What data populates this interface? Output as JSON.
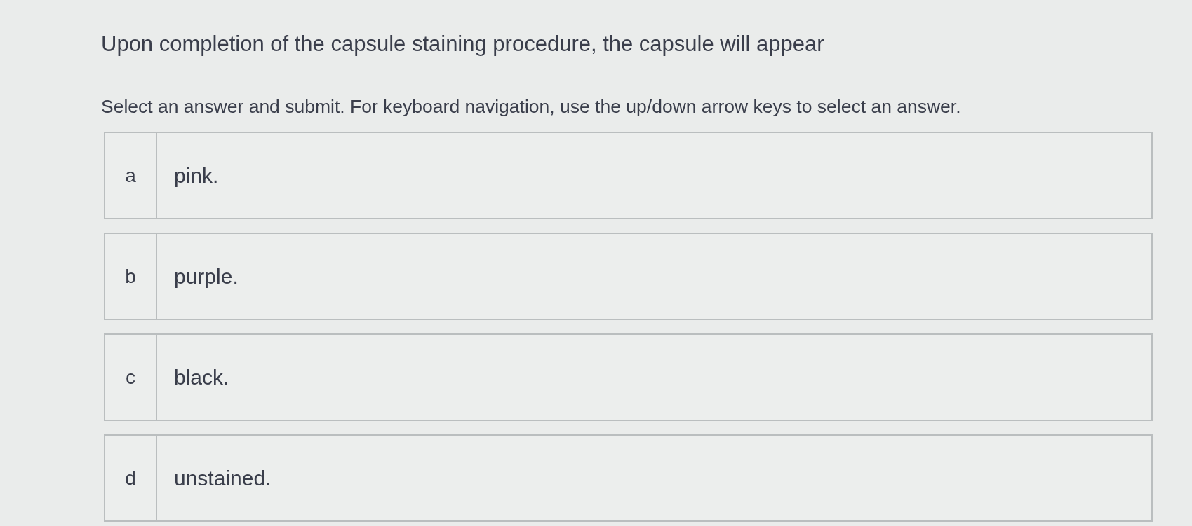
{
  "question": "Upon completion of the capsule staining procedure, the capsule will appear",
  "instruction": "Select an answer and submit. For keyboard navigation, use the up/down arrow keys to select an answer.",
  "options": [
    {
      "letter": "a",
      "text": "pink.",
      "selected": false
    },
    {
      "letter": "b",
      "text": "purple.",
      "selected": false
    },
    {
      "letter": "c",
      "text": "black.",
      "selected": false
    },
    {
      "letter": "d",
      "text": "unstained.",
      "selected": false
    }
  ]
}
